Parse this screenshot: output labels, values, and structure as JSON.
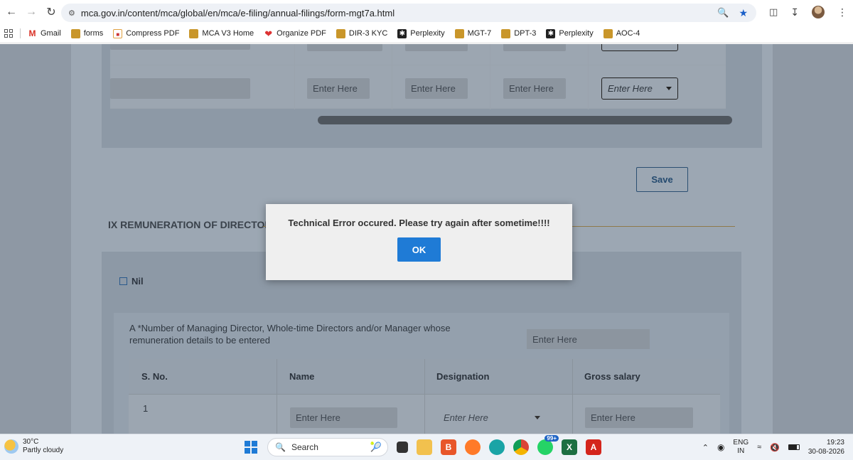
{
  "browser": {
    "url": "mca.gov.in/content/mca/global/en/mca/e-filing/annual-filings/form-mgt7a.html",
    "bookmarks": [
      {
        "label": "Gmail",
        "icon": "gmail-icon"
      },
      {
        "label": "forms",
        "icon": "emblem-icon"
      },
      {
        "label": "Compress PDF",
        "icon": "pdf-icon"
      },
      {
        "label": "MCA V3 Home",
        "icon": "emblem-icon"
      },
      {
        "label": "Organize PDF",
        "icon": "heart-icon"
      },
      {
        "label": "DIR-3 KYC",
        "icon": "emblem-icon"
      },
      {
        "label": "Perplexity",
        "icon": "perplexity-icon"
      },
      {
        "label": "MGT-7",
        "icon": "emblem-icon"
      },
      {
        "label": "DPT-3",
        "icon": "emblem-icon"
      },
      {
        "label": "Perplexity",
        "icon": "perplexity-icon"
      },
      {
        "label": "AOC-4",
        "icon": "emblem-icon"
      }
    ]
  },
  "form": {
    "top_table": {
      "input_placeholder": "Enter Here",
      "select_placeholder": "Enter Here"
    },
    "save_label": "Save",
    "section_title": "IX  REMUNERATION OF DIRECTOR",
    "nil_label": "Nil",
    "question_text": "A *Number of  Managing Director, Whole-time Directors and/or Manager whose remuneration details to be entered",
    "question_placeholder": "Enter Here",
    "table": {
      "headers": [
        "S. No.",
        "Name",
        "Designation",
        "Gross salary"
      ],
      "rows": [
        {
          "sno": "1",
          "name_placeholder": "Enter Here",
          "designation_placeholder": "Enter Here",
          "salary_placeholder": "Enter Here"
        }
      ]
    }
  },
  "dialog": {
    "message": "Technical Error occured. Please try again after sometime!!!!",
    "ok_label": "OK"
  },
  "taskbar": {
    "temperature": "30°C",
    "weather": "Partly cloudy",
    "search_label": "Search",
    "whatsapp_badge": "99+",
    "lang_top": "ENG",
    "lang_bottom": "IN",
    "time": "19:23",
    "date": "30-08-2026"
  },
  "colors": {
    "dialog_ok": "#1f7bd6",
    "save_border": "#2b4f72"
  }
}
